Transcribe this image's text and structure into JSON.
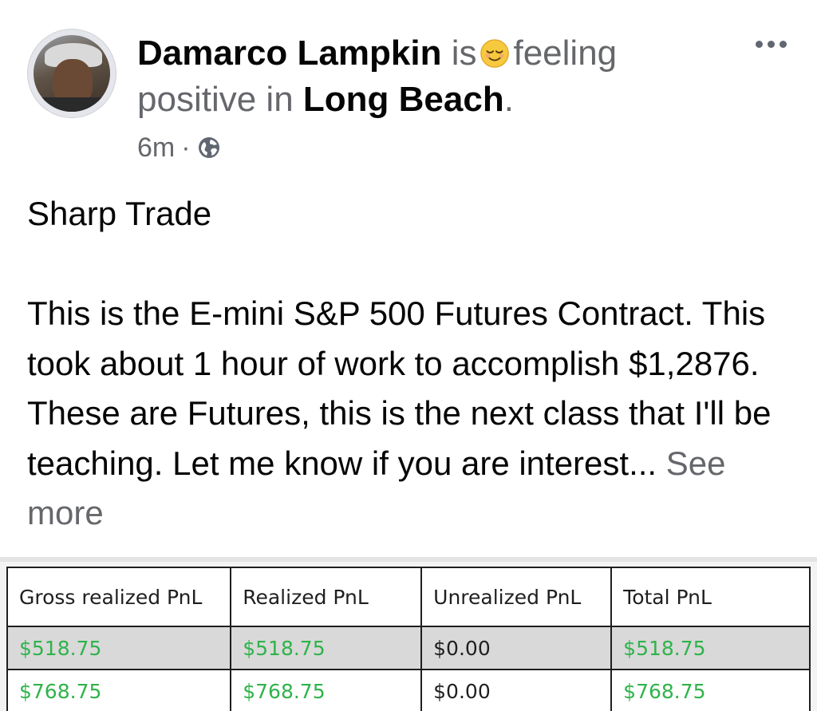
{
  "post": {
    "author": "Damarco Lampkin",
    "is_text": "is",
    "feeling_text": "feeling",
    "feeling_value": "positive",
    "in_text": "in",
    "location": "Long Beach",
    "location_suffix": ".",
    "timestamp": "6m",
    "separator": "·",
    "privacy_icon": "globe-icon",
    "feeling_icon": "relieved-face-emoji",
    "more_icon": "more-options-icon",
    "title": "Sharp Trade",
    "body": "This is the E-mini S&P 500 Futures Contract. This took about 1 hour of work to accomplish $1,2876. These are Futures, this is the next class that I'll be teaching. Let me know if you are interest...",
    "see_more": "See more"
  },
  "pnl_table": {
    "headers": [
      "Gross realized PnL",
      "Realized PnL",
      "Unrealized PnL",
      "Total PnL"
    ],
    "rows": [
      [
        "$518.75",
        "$518.75",
        "$0.00",
        "$518.75"
      ],
      [
        "$768.75",
        "$768.75",
        "$0.00",
        "$768.75"
      ]
    ]
  },
  "colors": {
    "positive_value": "#2fb34a",
    "muted_text": "#65676b",
    "highlight_row": "#d9d9d9"
  }
}
